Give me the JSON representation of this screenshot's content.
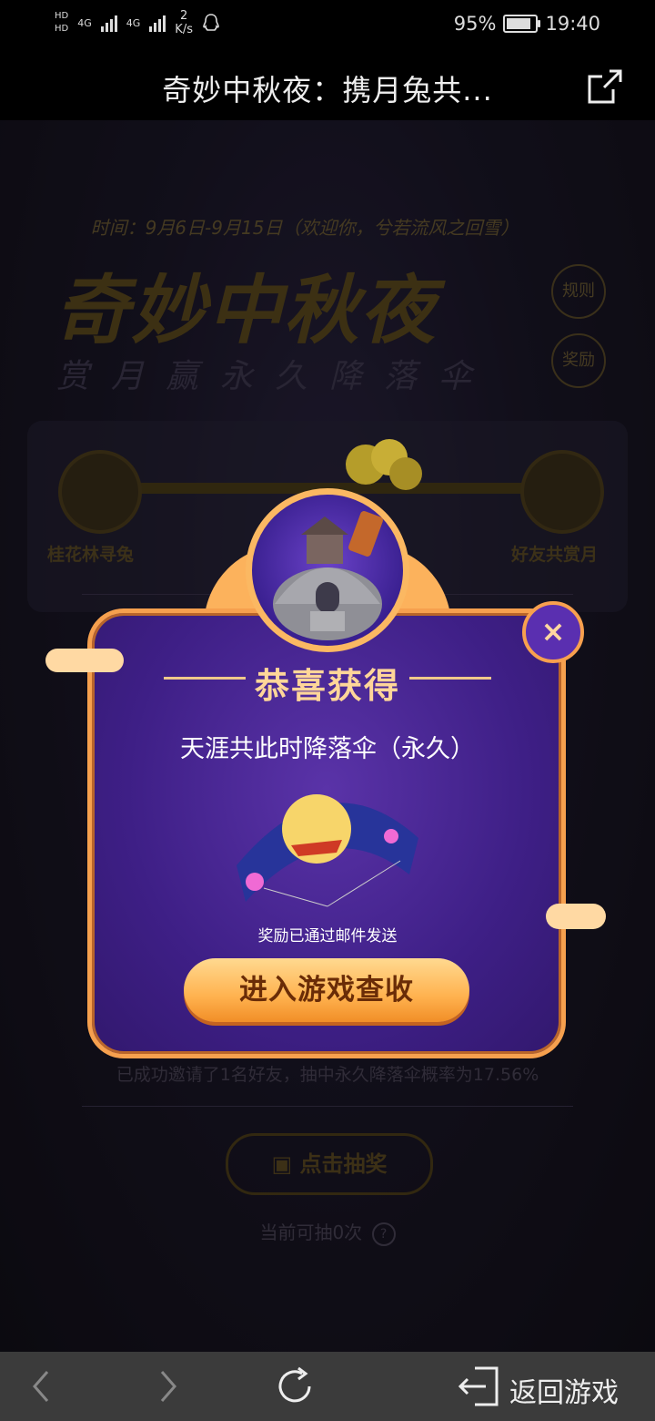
{
  "status_bar": {
    "hd1": "HD",
    "hd2": "HD",
    "net1": "4G",
    "net2": "4G",
    "speed_value": "2",
    "speed_unit": "K/s",
    "battery": "95%",
    "time": "19:40"
  },
  "title_bar": {
    "title": "奇妙中秋夜：携月兔共...",
    "share_icon": "share-icon"
  },
  "background_page": {
    "time_text": "时间：9月6日-9月15日（欢迎你，兮若流风之回雪）",
    "big_title": "奇妙中秋夜",
    "subtitle": "赏月赢永久降落伞",
    "rules_button": "规则",
    "rewards_button": "奖励",
    "node_left_label": "桂花林寻兔",
    "node_right_label": "好友共赏月",
    "invite_text": "已成功邀请了1名好友，抽中永久降落伞概率为17.56%",
    "draw_button": "点击抽奖",
    "draw_count": "当前可抽0次",
    "help_icon": "?"
  },
  "modal": {
    "headline": "恭喜获得",
    "item_name": "天涯共此时降落伞（永久）",
    "note": "奖励已通过邮件发送",
    "cta_label": "进入游戏查收",
    "close_label": "×",
    "accent_color": "#f6a04e",
    "panel_color": "#3e1f86"
  },
  "bottom_nav": {
    "back_icon": "chevron-left-icon",
    "forward_icon": "chevron-right-icon",
    "refresh_icon": "refresh-icon",
    "return_icon": "exit-icon",
    "return_label": "返回游戏"
  }
}
